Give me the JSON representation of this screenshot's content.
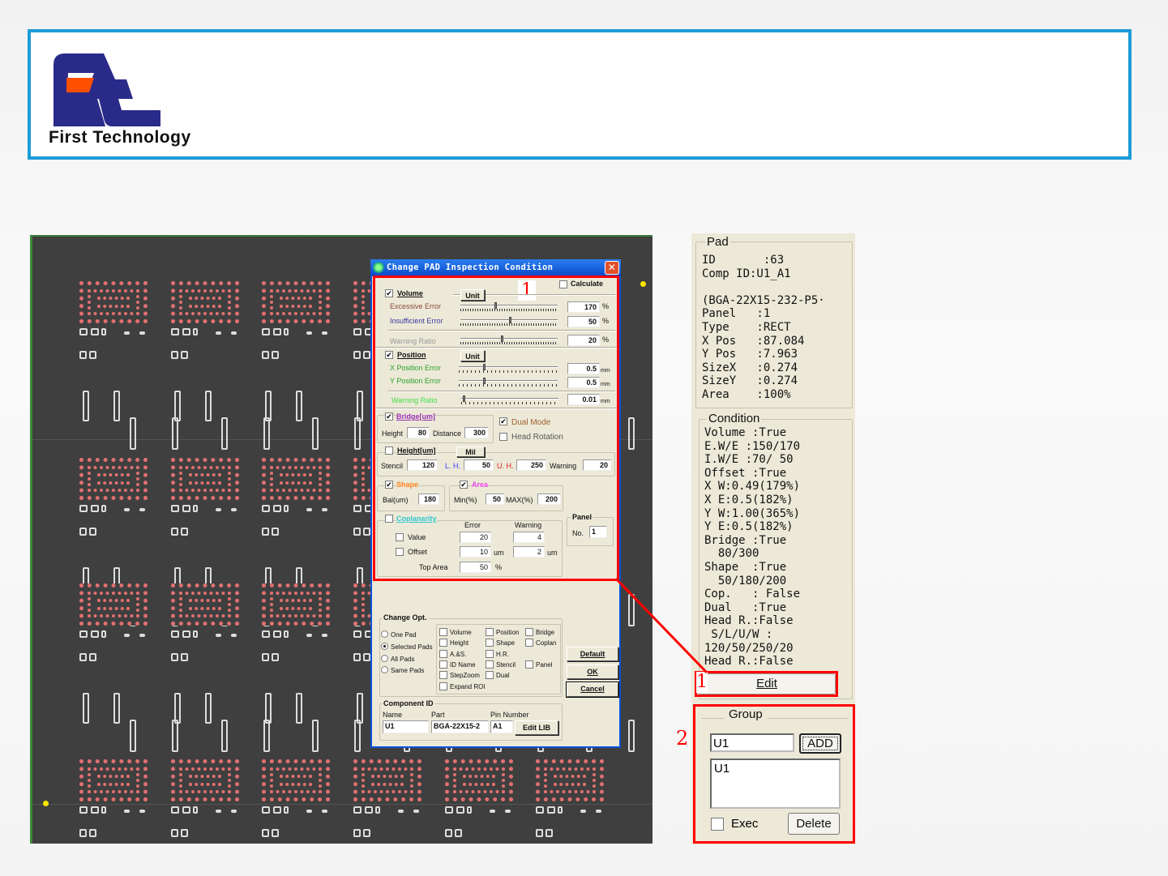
{
  "header": {
    "brand": "First Technology",
    "logo_colors": {
      "blue": "#2a2a8a",
      "orange": "#ff5000"
    }
  },
  "dialog": {
    "title": "Change PAD Inspection Condition",
    "calculate": "Calculate",
    "annotation_1": "1",
    "volume": {
      "label": "Volume",
      "unit": "Unit",
      "excessive": "Excessive Error",
      "excessive_val": "170",
      "insufficient": "Insufficient Error",
      "insufficient_val": "50",
      "warning": "Warning Ratio",
      "warning_val": "20",
      "pct": "%"
    },
    "position": {
      "label": "Position",
      "unit": "Unit",
      "x": "X Position Error",
      "x_val": "0.5",
      "y": "Y Position Error",
      "y_val": "0.5",
      "warning": "Warning Ratio",
      "warning_val": "0.01",
      "mm": "mm"
    },
    "bridge": {
      "label": "Bridge[um]",
      "height": "Height",
      "height_val": "80",
      "distance": "Distance",
      "distance_val": "300"
    },
    "dual_mode": "Dual Mode",
    "head_rotation": "Head Rotation",
    "height": {
      "label": "Height[um]",
      "mil": "Mil",
      "stencil": "Stencil",
      "stencil_val": "120",
      "lh": "L. H.",
      "lh_val": "50",
      "uh": "U. H.",
      "uh_val": "250",
      "warning": "Warning",
      "warning_val": "20"
    },
    "shape": {
      "label": "Shape",
      "bal": "Bal(um)",
      "bal_val": "180"
    },
    "area": {
      "label": "Area",
      "min": "Min(%)",
      "min_val": "50",
      "max": "MAX(%)",
      "max_val": "200"
    },
    "coplanarity": {
      "label": "Coplanarity",
      "error": "Error",
      "warning": "Warning",
      "value": "Value",
      "value_err": "20",
      "value_warn": "4",
      "offset": "Offset",
      "offset_err": "10",
      "offset_warn": "2",
      "um": "um",
      "top_area": "Top Area",
      "top_area_val": "50",
      "pct": "%"
    },
    "panel": {
      "label": "Panel",
      "no": "No.",
      "no_val": "1"
    },
    "change_opt": {
      "label": "Change Opt.",
      "radios": [
        "One Pad",
        "Selected Pads",
        "All Pads",
        "Same Pads"
      ],
      "selected": 1,
      "checks": [
        "Volume",
        "Height",
        "A.&S.",
        "ID Name",
        "StepZoom",
        "Expand ROI",
        "Position",
        "Shape",
        "H.R.",
        "Stencil",
        "Dual",
        "Bridge",
        "Coplan",
        "Panel"
      ]
    },
    "buttons": {
      "default": "Default",
      "ok": "OK",
      "cancel": "Cancel"
    },
    "component": {
      "label": "Component ID",
      "name": "Name",
      "part": "Part",
      "pin": "Pin Number",
      "name_val": "U1",
      "part_val": "BGA-22X15-2",
      "pin_val": "A1",
      "edit_lib": "Edit LIB"
    }
  },
  "pad": {
    "title": "Pad",
    "lines": [
      "ID       :63",
      "Comp ID:U1_A1",
      "",
      "(BGA-22X15-232-P5·",
      "Panel   :1",
      "Type    :RECT",
      "X Pos   :87.084",
      "Y Pos   :7.963",
      "SizeX   :0.274",
      "SizeY   :0.274",
      "Area    :100%"
    ]
  },
  "condition": {
    "title": "Condition",
    "lines": [
      "Volume :True",
      "E.W/E :150/170",
      "I.W/E :70/ 50",
      "Offset :True",
      "X W:0.49(179%)",
      "X E:0.5(182%)",
      "Y W:1.00(365%)",
      "Y E:0.5(182%)",
      "Bridge :True",
      "  80/300",
      "Shape  :True",
      "  50/180/200",
      "Cop.   : False",
      "Dual   :True",
      "Head R.:False",
      " S/L/U/W :",
      "120/50/250/20",
      "Head R.:False"
    ],
    "edit": "Edit",
    "annotation": "1"
  },
  "group": {
    "title": "Group",
    "input": "U1",
    "add": "ADD",
    "list": [
      "U1"
    ],
    "exec": "Exec",
    "delete": "Delete",
    "annotation": "2"
  }
}
